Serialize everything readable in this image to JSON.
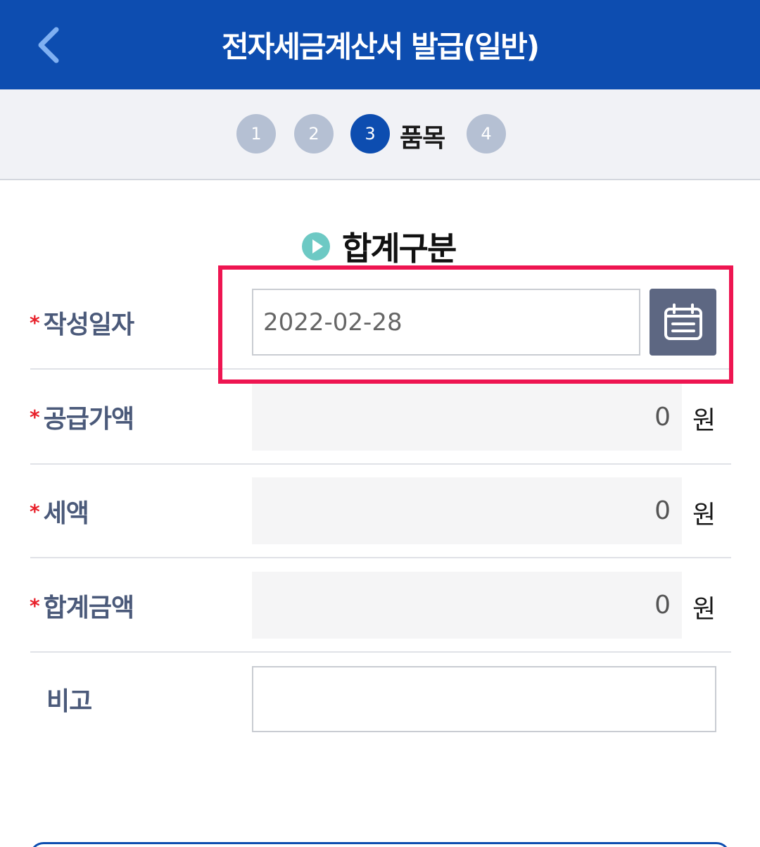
{
  "header": {
    "title": "전자세금계산서 발급(일반)",
    "back_icon": "chevron-left-icon"
  },
  "steps": {
    "items": [
      {
        "num": "1"
      },
      {
        "num": "2"
      },
      {
        "num": "3",
        "label": "품목",
        "active": true
      },
      {
        "num": "4"
      }
    ]
  },
  "section": {
    "title": "합계구분",
    "icon": "play-circle-icon"
  },
  "form": {
    "date": {
      "label": "작성일자",
      "required_mark": "*",
      "value": "2022-02-28",
      "calendar_icon": "calendar-icon"
    },
    "supply": {
      "label": "공급가액",
      "required_mark": "*",
      "value": "0",
      "unit": "원"
    },
    "tax": {
      "label": "세액",
      "required_mark": "*",
      "value": "0",
      "unit": "원"
    },
    "total": {
      "label": "합계금액",
      "required_mark": "*",
      "value": "0",
      "unit": "원"
    },
    "note": {
      "label": "비고",
      "value": ""
    }
  },
  "colors": {
    "header_bg": "#0d4db0",
    "step_inactive": "#b5c0d3",
    "step_active": "#0d4db0",
    "highlight": "#ee1551",
    "required": "#e8212b",
    "label": "#4b5a7a",
    "calendar_btn": "#5d6782"
  }
}
